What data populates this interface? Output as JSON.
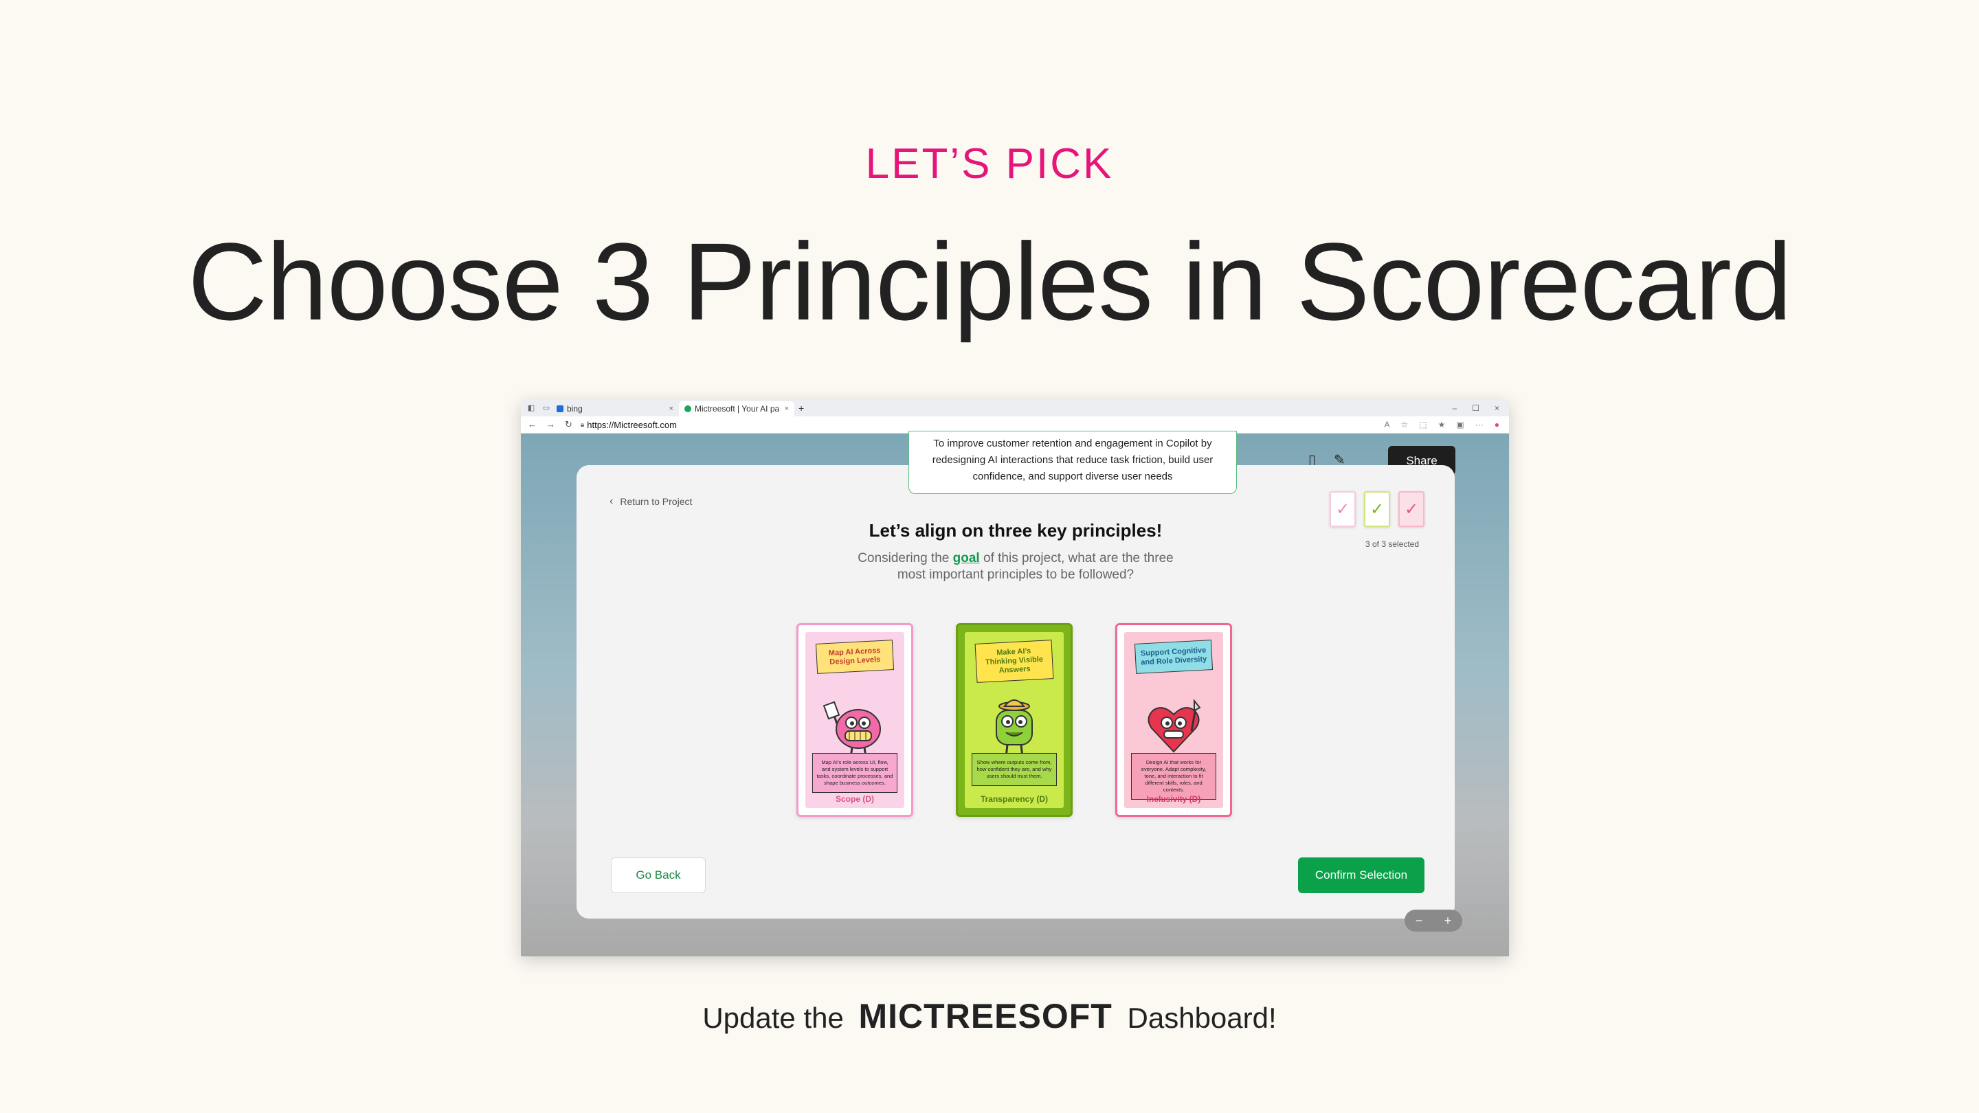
{
  "slide": {
    "kicker": "LET’S PICK",
    "headline": "Choose 3 Principles in Scorecard",
    "footer_prefix": "Update the",
    "footer_brand": "MICTREESOFT",
    "footer_suffix": "Dashboard!"
  },
  "browser": {
    "tabs": [
      {
        "label": "bing",
        "close": "×"
      },
      {
        "label": "Mictreesoft | Your AI pa",
        "close": "×"
      }
    ],
    "new_tab": "+",
    "window_controls": [
      "–",
      "☐",
      "×"
    ],
    "nav": [
      "←",
      "→",
      "↻"
    ],
    "url": "https://Mictreesoft.com"
  },
  "app": {
    "share_label": "Share",
    "zoom_minus": "−",
    "zoom_plus": "+",
    "goal_text": "To improve customer retention and engagement in Copilot by redesigning AI interactions that reduce task friction, build user confidence, and support diverse user needs",
    "return_label": "Return to Project",
    "title": "Let’s align on three key principles!",
    "subtitle_pre": "Considering the",
    "subtitle_link": "goal",
    "subtitle_post": "of this project, what are the three most important principles to be followed?",
    "picks": [
      {
        "check": "✓",
        "color": "#f7c9e2"
      },
      {
        "check": "✓",
        "color": "#d6ec8c"
      },
      {
        "check": "✓",
        "color": "#f7b8cb"
      }
    ],
    "selection_count": "3 of 3 selected",
    "cards": [
      {
        "title": "Map AI Across Design Levels",
        "description": "Map AI’s role across UI, flow, and system levels to support tasks, coordinate processes, and shape business outcomes.",
        "name": "Scope (D)",
        "border": "#f59ac8",
        "bg": "#fbd3e8",
        "label_bg": "#ffe27a",
        "desc_bg": "#f7a8cf",
        "name_color": "#d4557f"
      },
      {
        "title": "Make AI’s Thinking Visible Answers",
        "description": "Show where outputs come from, how confident they are, and why users should trust them.",
        "name": "Transparency (D)",
        "border": "#7bb51a",
        "bg": "#c9ea4a",
        "label_bg": "#ffe44d",
        "desc_bg": "#a8d94a",
        "name_color": "#4c7a10"
      },
      {
        "title": "Support Cognitive and Role Diversity",
        "description": "Design AI that works for everyone. Adapt complexity, tone, and interaction to fit different skills, roles, and contexts.",
        "name": "Inclusivity (D)",
        "border": "#f0688f",
        "bg": "#fbc8d5",
        "label_bg": "#8fdde6",
        "desc_bg": "#f7a1b8",
        "name_color": "#d23a62"
      }
    ],
    "go_back_label": "Go Back",
    "confirm_label": "Confirm Selection"
  }
}
